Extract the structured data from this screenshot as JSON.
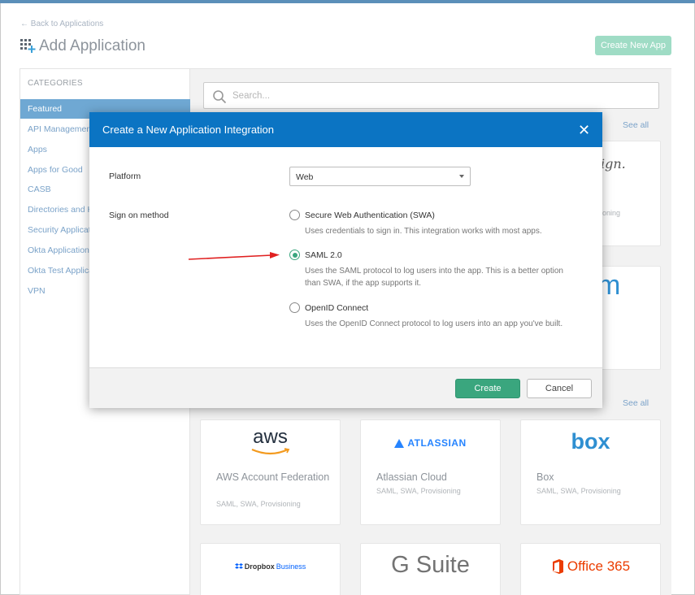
{
  "header": {
    "back_link": "← Back to Applications",
    "page_title": "Add Application",
    "create_new_app": "Create New App"
  },
  "sidebar": {
    "heading": "CATEGORIES",
    "items": [
      {
        "label": "Featured",
        "active": true
      },
      {
        "label": "API Management"
      },
      {
        "label": "Apps"
      },
      {
        "label": "Apps for Good"
      },
      {
        "label": "CASB"
      },
      {
        "label": "Directories and HR"
      },
      {
        "label": "Security Applications"
      },
      {
        "label": "Okta Applications"
      },
      {
        "label": "Okta Test Applications"
      },
      {
        "label": "VPN"
      }
    ]
  },
  "search": {
    "placeholder": "Search..."
  },
  "catalog": {
    "see_all_1": "See all",
    "see_all_2": "See all",
    "partial_logo_1": "ign.",
    "partial_sub_1": "ioning",
    "partial_logo_2": "m",
    "cards": [
      {
        "logo": "aws",
        "name": "AWS Account Federation",
        "sub": "SAML, SWA, Provisioning"
      },
      {
        "logo": "ATLASSIAN",
        "name": "Atlassian Cloud",
        "sub": "SAML, SWA, Provisioning"
      },
      {
        "logo": "box",
        "name": "Box",
        "sub": "SAML, SWA, Provisioning"
      }
    ],
    "bottom_logos": {
      "dropbox": "Dropbox",
      "dropbox_business": "Business",
      "gsuite": "G Suite",
      "office": "Office 365"
    }
  },
  "modal": {
    "title": "Create a New Application Integration",
    "close": "✕",
    "platform_label": "Platform",
    "platform_value": "Web",
    "sign_on_label": "Sign on method",
    "options": [
      {
        "title": "Secure Web Authentication (SWA)",
        "desc": "Uses credentials to sign in. This integration works with most apps.",
        "checked": false
      },
      {
        "title": "SAML 2.0",
        "desc": "Uses the SAML protocol to log users into the app. This is a better option than SWA, if the app supports it.",
        "checked": true
      },
      {
        "title": "OpenID Connect",
        "desc": "Uses the OpenID Connect protocol to log users into an app you've built.",
        "checked": false
      }
    ],
    "create": "Create",
    "cancel": "Cancel"
  },
  "colors": {
    "accent_blue": "#0b74c3",
    "okta_green": "#3aa67e",
    "annotation_red": "#e02020"
  }
}
